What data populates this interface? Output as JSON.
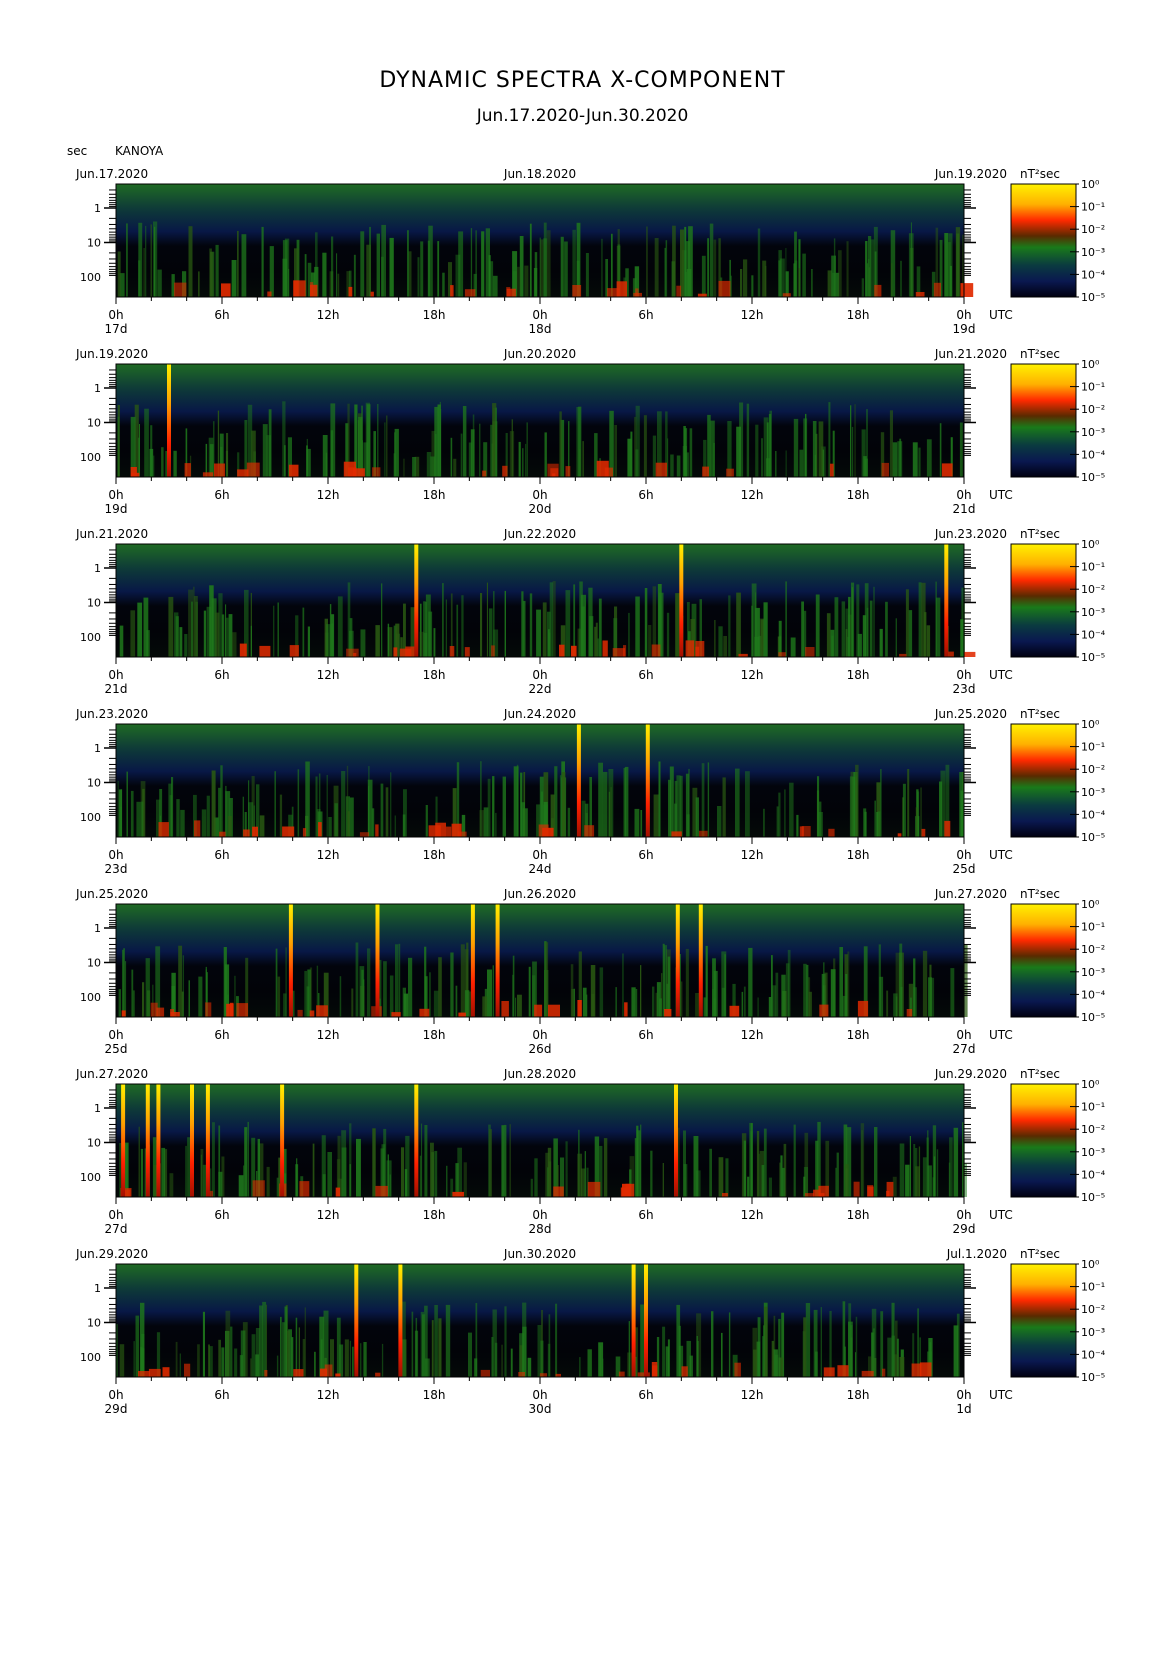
{
  "page": {
    "title": "DYNAMIC SPECTRA X-COMPONENT",
    "subtitle": "Jun.17.2020-Jun.30.2020",
    "unit_label": "sec",
    "station": "KANOYA",
    "colorbar_title": "nT²sec"
  },
  "chart_data": {
    "type": "heatmap",
    "title": "DYNAMIC SPECTRA X-COMPONENT",
    "subtitle": "Jun.17.2020-Jun.30.2020",
    "station": "KANOYA",
    "y_axis": {
      "label": "sec",
      "scale": "log",
      "ticks": [
        "1",
        "10",
        "100"
      ]
    },
    "x_axis": {
      "ticks": [
        "0h",
        "6h",
        "12h",
        "18h",
        "0h",
        "6h",
        "12h",
        "18h",
        "0h"
      ],
      "unit": "UTC"
    },
    "colorbar": {
      "unit": "nT²sec",
      "scale": "log",
      "range": [
        1e-05,
        1
      ],
      "ticks": [
        "10⁰",
        "10⁻¹",
        "10⁻²",
        "10⁻³",
        "10⁻⁴",
        "10⁻⁵"
      ],
      "colors": [
        "#000010",
        "#0a1a50",
        "#1a7a1a",
        "#ff2000",
        "#ffee00"
      ]
    },
    "panels": [
      {
        "dates": [
          "Jun.17.2020",
          "Jun.18.2020",
          "Jun.19.2020"
        ],
        "day_labels": [
          "17d",
          "18d",
          "19d"
        ],
        "spikes": []
      },
      {
        "dates": [
          "Jun.19.2020",
          "Jun.20.2020",
          "Jun.21.2020"
        ],
        "day_labels": [
          "19d",
          "20d",
          "21d"
        ],
        "spikes": [
          3.0
        ]
      },
      {
        "dates": [
          "Jun.21.2020",
          "Jun.22.2020",
          "Jun.23.2020"
        ],
        "day_labels": [
          "21d",
          "22d",
          "23d"
        ],
        "spikes": [
          17.0,
          32.0,
          47.0
        ]
      },
      {
        "dates": [
          "Jun.23.2020",
          "Jun.24.2020",
          "Jun.25.2020"
        ],
        "day_labels": [
          "23d",
          "24d",
          "25d"
        ],
        "spikes": [
          26.2,
          30.1
        ]
      },
      {
        "dates": [
          "Jun.25.2020",
          "Jun.26.2020",
          "Jun.27.2020"
        ],
        "day_labels": [
          "25d",
          "26d",
          "27d"
        ],
        "spikes": [
          9.9,
          14.8,
          20.2,
          21.6,
          31.8,
          33.1
        ]
      },
      {
        "dates": [
          "Jun.27.2020",
          "Jun.28.2020",
          "Jun.29.2020"
        ],
        "day_labels": [
          "27d",
          "28d",
          "29d"
        ],
        "spikes": [
          0.4,
          1.8,
          2.4,
          4.3,
          5.2,
          9.4,
          17.0,
          31.7
        ]
      },
      {
        "dates": [
          "Jun.29.2020",
          "Jun.30.2020",
          "Jul.1.2020"
        ],
        "day_labels": [
          "29d",
          "30d",
          "1d"
        ],
        "spikes": [
          13.6,
          16.1,
          29.3,
          30.0
        ]
      }
    ]
  }
}
